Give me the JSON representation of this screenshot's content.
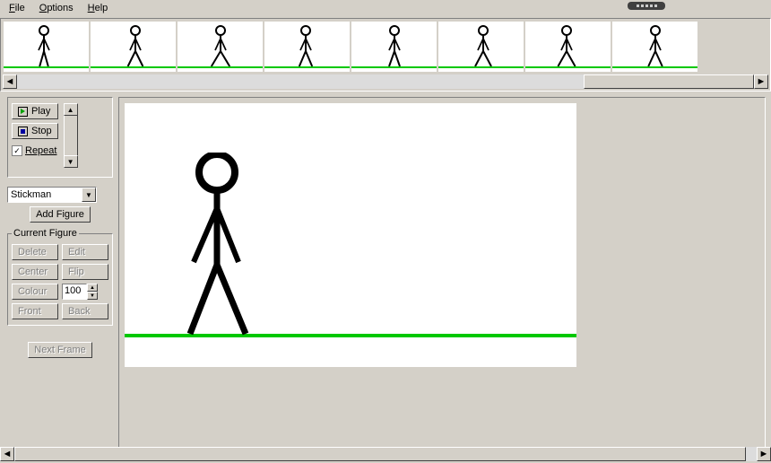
{
  "menu": {
    "file": "File",
    "options": "Options",
    "help": "Help"
  },
  "playback": {
    "play": "Play",
    "stop": "Stop",
    "repeat": "Repeat",
    "repeatChecked": true
  },
  "figure": {
    "dropdown": "Stickman",
    "addFigure": "Add Figure",
    "legend": "Current Figure",
    "delete": "Delete",
    "edit": "Edit",
    "center": "Center",
    "flip": "Flip",
    "colour": "Colour",
    "opacity": "100",
    "front": "Front",
    "back": "Back"
  },
  "nextFrame": "Next Frame",
  "frameCount": 8
}
